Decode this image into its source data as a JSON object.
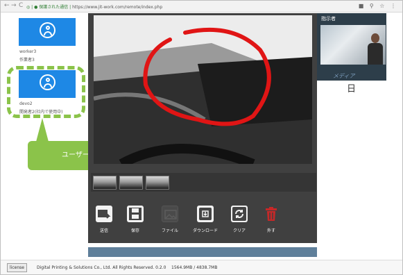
{
  "browser": {
    "url_prefix": "◎ | ● 保護された通信 |",
    "url": "https://www.jit-work.com/remote/index.php"
  },
  "users": [
    {
      "name": "worker3",
      "role": "作業者3"
    },
    {
      "name": "devo2",
      "role": "開発者2(社内で使用中)"
    }
  ],
  "callout": {
    "text": "ユーザーアイコンを選択"
  },
  "toolbar": {
    "send_label": "送信",
    "save_label": "保存",
    "file_label": "ファイル",
    "download_label": "ダウンロード",
    "clear_label": "クリア",
    "delete_label": "外す"
  },
  "right_panel": {
    "title": "指示者",
    "media_label": "メディア",
    "day_glyph": "日"
  },
  "footer": {
    "license_label": "license",
    "copyright": "Digital Printing & Solutions Co., Ltd. All Rights Reserved. 0.2.0",
    "memory": "1564.9MB / 4838.7MB"
  },
  "colors": {
    "accent_blue": "#1e88e5",
    "callout_green": "#8bc34a",
    "annotation_red": "#e01515",
    "delete_red": "#c62828"
  }
}
